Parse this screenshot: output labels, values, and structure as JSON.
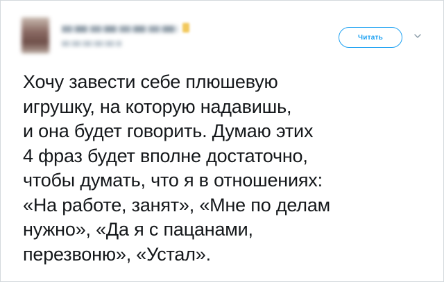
{
  "header": {
    "follow_label": "Читать"
  },
  "tweet": {
    "lines": [
      "Хочу завести себе плюшевую",
      "игрушку, на которую надавишь,",
      "и она будет говорить. Думаю этих",
      "4 фраз будет вполне достаточно,",
      "чтобы думать, что я в отношениях:",
      "«На работе, занят», «Мне по делам",
      "нужно», «Да я с пацанами,",
      "перезвоню», «Устал»."
    ]
  },
  "colors": {
    "accent": "#1da1f2",
    "text": "#14171a",
    "border": "#d3d8dc"
  },
  "icons": {
    "menu": "chevron-down-icon"
  }
}
